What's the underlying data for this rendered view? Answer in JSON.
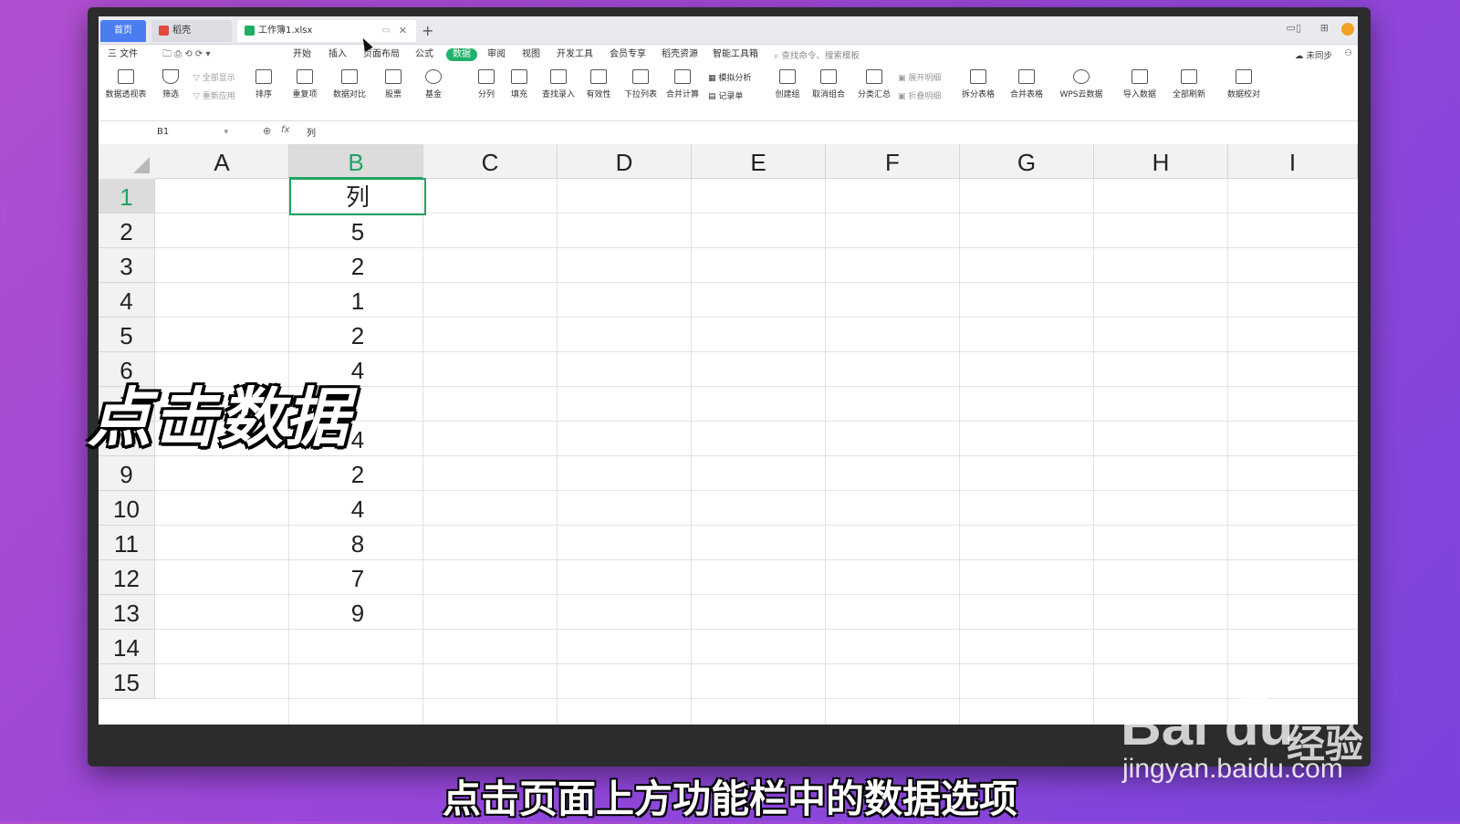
{
  "tabs": [
    {
      "label": "首页"
    },
    {
      "label": "稻壳"
    },
    {
      "label": "工作簿1.xlsx"
    }
  ],
  "menu": {
    "file": "三 文件",
    "items": [
      "开始",
      "插入",
      "页面布局",
      "公式",
      "数据",
      "审阅",
      "视图",
      "开发工具",
      "会员专享",
      "稻壳资源",
      "智能工具箱"
    ],
    "active": "数据",
    "search_placeholder": "查找命令、搜索模板",
    "sync": "未同步"
  },
  "ribbon": {
    "buttons": [
      "数据透视表",
      "筛选",
      "排序",
      "重复项",
      "数据对比",
      "股票",
      "基金",
      "分列",
      "填充",
      "查找录入",
      "有效性",
      "下拉列表",
      "合并计算",
      "创建组",
      "取消组合",
      "分类汇总",
      "拆分表格",
      "合并表格",
      "WPS云数据",
      "导入数据",
      "全部刷新",
      "数据校对"
    ],
    "small": [
      "全部显示",
      "重新应用",
      "模拟分析",
      "记录单",
      "展开明细",
      "折叠明细"
    ]
  },
  "formula_bar": {
    "name_box": "B1",
    "fx": "fx",
    "value": "列"
  },
  "sheet": {
    "columns": [
      "A",
      "B",
      "C",
      "D",
      "E",
      "F",
      "G",
      "H",
      "I"
    ],
    "selected_column": "B",
    "rows": [
      "1",
      "2",
      "3",
      "4",
      "5",
      "6",
      "7",
      "8",
      "9",
      "10",
      "11",
      "12",
      "13",
      "14",
      "15"
    ],
    "selected_row": "1",
    "column_b": [
      "列",
      "5",
      "2",
      "1",
      "2",
      "4",
      "",
      "4",
      "2",
      "4",
      "8",
      "7",
      "9",
      "",
      ""
    ]
  },
  "overlay": {
    "title": "点击数据",
    "subtitle": "点击页面上方功能栏中的数据选项"
  },
  "watermark": {
    "logo": "Bai du",
    "cn": "经验",
    "url": "jingyan.baidu.com"
  }
}
